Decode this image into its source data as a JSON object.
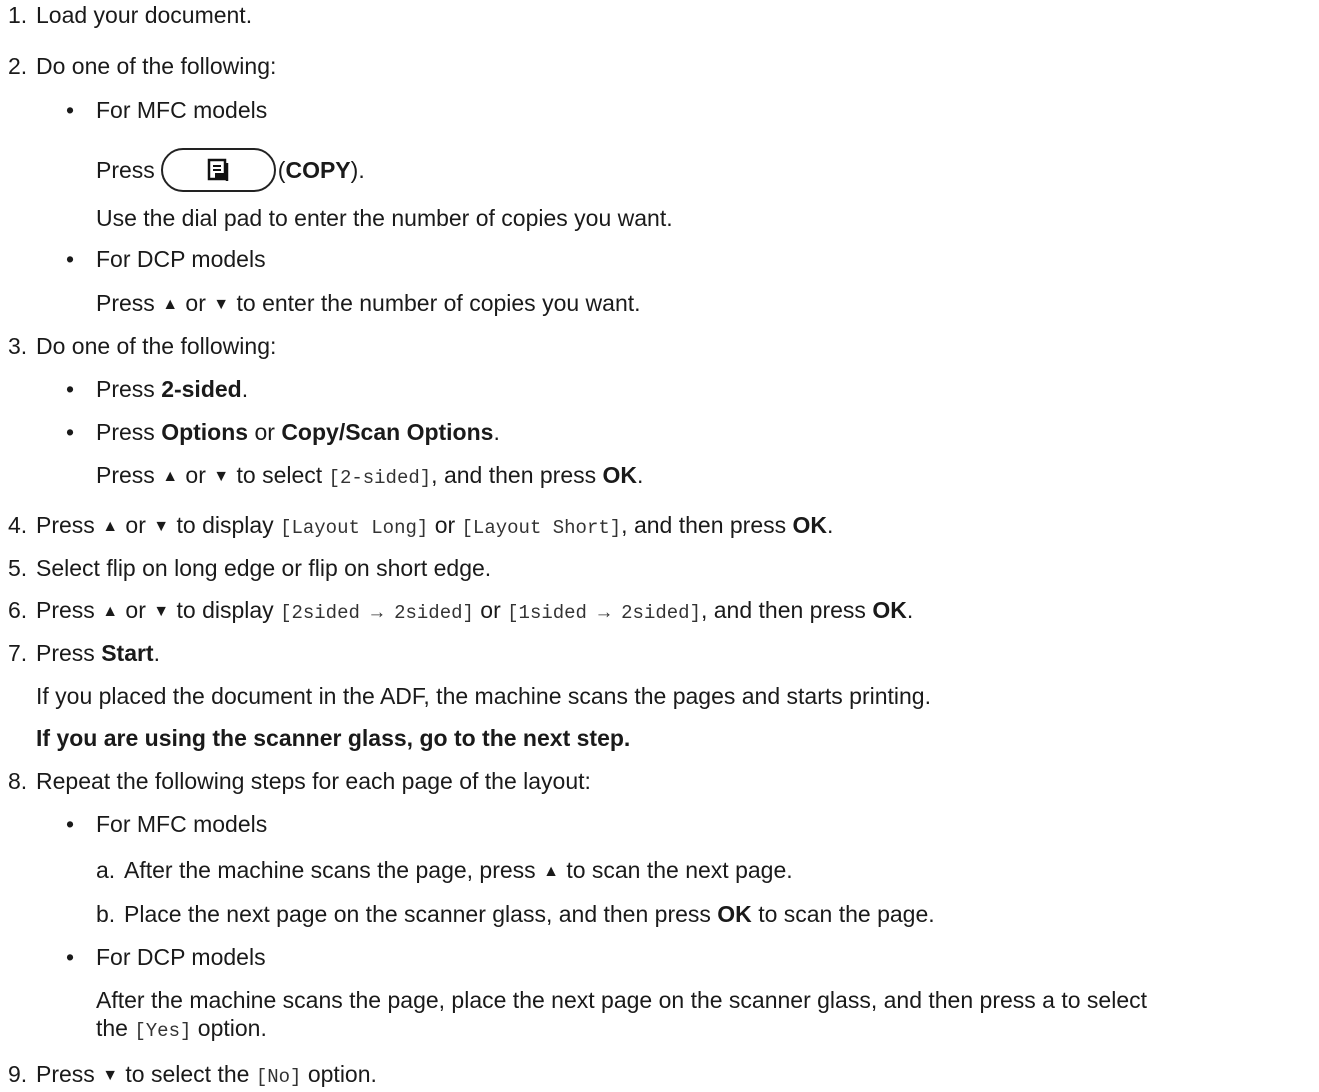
{
  "steps": [
    {
      "n": "1.",
      "text": "Load your document."
    },
    {
      "n": "2.",
      "text": "Do one of the following:"
    },
    {
      "n": "3.",
      "text": "Do one of the following:"
    },
    {
      "n": "4.",
      "press": "Press",
      "or": "or",
      "to_display": "to display",
      "code1": "[Layout Long]",
      "or2": "or",
      "code2": "[Layout Short]",
      "then": ", and then press",
      "ok": "OK",
      "end": "."
    },
    {
      "n": "5.",
      "text": "Select flip on long edge or flip on short edge."
    },
    {
      "n": "6.",
      "press": "Press",
      "or": "or",
      "to_display": "to display",
      "code1": "[2sided → 2sided]",
      "or2": "or",
      "code2": "[1sided → 2sided]",
      "then": ", and then press",
      "ok": "OK",
      "end": "."
    },
    {
      "n": "7.",
      "press": "Press",
      "bold": "Start",
      "end": "."
    },
    {
      "n": "8.",
      "text": "Repeat the following steps for each page of the layout:"
    },
    {
      "n": "9.",
      "press": "Press",
      "to_select": "to select the",
      "code": "[No]",
      "option": "option."
    }
  ],
  "step2": {
    "mfc_label": "For MFC models",
    "press": "Press",
    "copy_paren_open": "(",
    "copy_bold": "COPY",
    "copy_paren_close": ").",
    "dial_text": "Use the dial pad to enter the number of copies you want.",
    "dcp_label": "For DCP models",
    "dcp_press": "Press",
    "dcp_or": "or",
    "dcp_rest": "to enter the number of copies you want."
  },
  "step3": {
    "a_press": "Press",
    "a_bold": "2-sided",
    "b_press": "Press",
    "b_bold1": "Options",
    "b_or": "or",
    "b_bold2": "Copy/Scan Options",
    "c_press": "Press",
    "c_or": "or",
    "c_to_select": "to select",
    "c_code": "[2-sided]",
    "c_then": ", and then press",
    "c_ok": "OK"
  },
  "step7": {
    "adf_text": "If you placed the document in the ADF, the machine scans the pages and starts printing.",
    "glass_bold": "If you are using the scanner glass, go to the next step."
  },
  "step8": {
    "mfc_label": "For MFC models",
    "a_label": "a.",
    "a_text1": "After the machine scans the page, press",
    "a_text2": "to scan the next page.",
    "b_label": "b.",
    "b_text1": "Place the next page on the scanner glass, and then press",
    "b_ok": "OK",
    "b_text2": "to scan the page.",
    "dcp_label": "For DCP models",
    "dcp_line1": "After the machine scans the page, place the next page on the scanner glass, and then press a to select",
    "dcp_the": "the",
    "dcp_code": "[Yes]",
    "dcp_option": "option."
  },
  "symbols": {
    "up": "▲",
    "down": "▼",
    "bullet": "•"
  },
  "icons": {
    "copy": "copy-icon"
  }
}
